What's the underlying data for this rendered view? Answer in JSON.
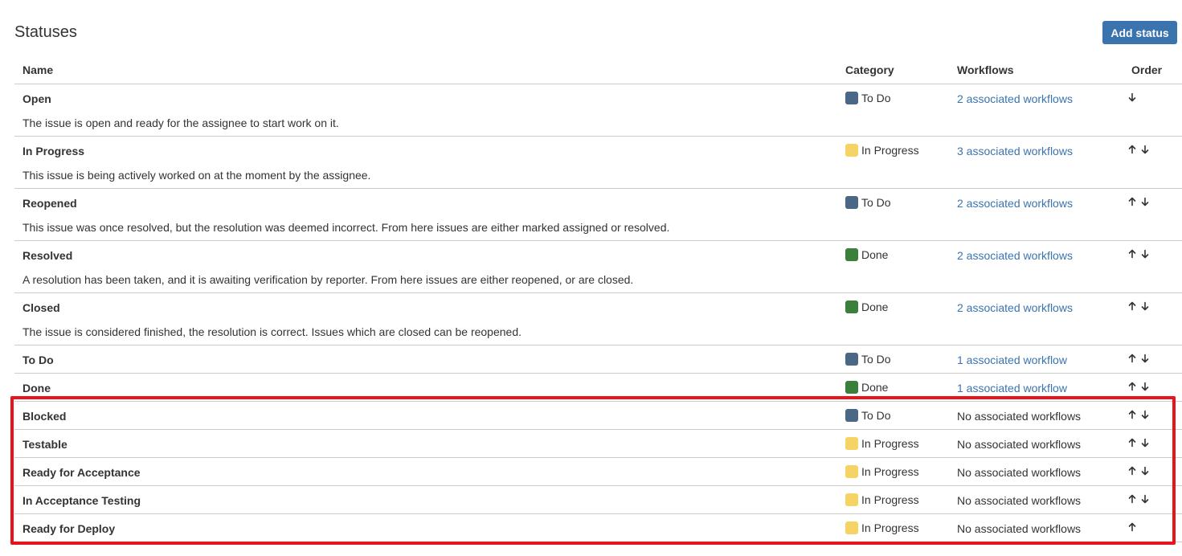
{
  "page": {
    "title": "Statuses",
    "add_button_label": "Add status"
  },
  "table": {
    "headers": {
      "name": "Name",
      "category": "Category",
      "workflows": "Workflows",
      "order": "Order"
    },
    "rows": [
      {
        "name": "Open",
        "description": "The issue is open and ready for the assignee to start work on it.",
        "category": "To Do",
        "category_color": "#4a6785",
        "workflows": "2 associated workflows",
        "workflows_link": true,
        "up": false,
        "down": true
      },
      {
        "name": "In Progress",
        "description": "This issue is being actively worked on at the moment by the assignee.",
        "category": "In Progress",
        "category_color": "#f6d365",
        "workflows": "3 associated workflows",
        "workflows_link": true,
        "up": true,
        "down": true
      },
      {
        "name": "Reopened",
        "description": "This issue was once resolved, but the resolution was deemed incorrect. From here issues are either marked assigned or resolved.",
        "category": "To Do",
        "category_color": "#4a6785",
        "workflows": "2 associated workflows",
        "workflows_link": true,
        "up": true,
        "down": true
      },
      {
        "name": "Resolved",
        "description": "A resolution has been taken, and it is awaiting verification by reporter. From here issues are either reopened, or are closed.",
        "category": "Done",
        "category_color": "#3b7f3b",
        "workflows": "2 associated workflows",
        "workflows_link": true,
        "up": true,
        "down": true
      },
      {
        "name": "Closed",
        "description": "The issue is considered finished, the resolution is correct. Issues which are closed can be reopened.",
        "category": "Done",
        "category_color": "#3b7f3b",
        "workflows": "2 associated workflows",
        "workflows_link": true,
        "up": true,
        "down": true
      },
      {
        "name": "To Do",
        "description": "",
        "category": "To Do",
        "category_color": "#4a6785",
        "workflows": "1 associated workflow",
        "workflows_link": true,
        "up": true,
        "down": true
      },
      {
        "name": "Done",
        "description": "",
        "category": "Done",
        "category_color": "#3b7f3b",
        "workflows": "1 associated workflow",
        "workflows_link": true,
        "up": true,
        "down": true
      },
      {
        "name": "Blocked",
        "description": "",
        "category": "To Do",
        "category_color": "#4a6785",
        "workflows": "No associated workflows",
        "workflows_link": false,
        "up": true,
        "down": true
      },
      {
        "name": "Testable",
        "description": "",
        "category": "In Progress",
        "category_color": "#f6d365",
        "workflows": "No associated workflows",
        "workflows_link": false,
        "up": true,
        "down": true
      },
      {
        "name": "Ready for Acceptance",
        "description": "",
        "category": "In Progress",
        "category_color": "#f6d365",
        "workflows": "No associated workflows",
        "workflows_link": false,
        "up": true,
        "down": true
      },
      {
        "name": "In Acceptance Testing",
        "description": "",
        "category": "In Progress",
        "category_color": "#f6d365",
        "workflows": "No associated workflows",
        "workflows_link": false,
        "up": true,
        "down": true
      },
      {
        "name": "Ready for Deploy",
        "description": "",
        "category": "In Progress",
        "category_color": "#f6d365",
        "workflows": "No associated workflows",
        "workflows_link": false,
        "up": true,
        "down": false
      }
    ]
  },
  "colors": {
    "link": "#3b73af",
    "button": "#3b73af",
    "highlight_border": "#e8141b"
  }
}
